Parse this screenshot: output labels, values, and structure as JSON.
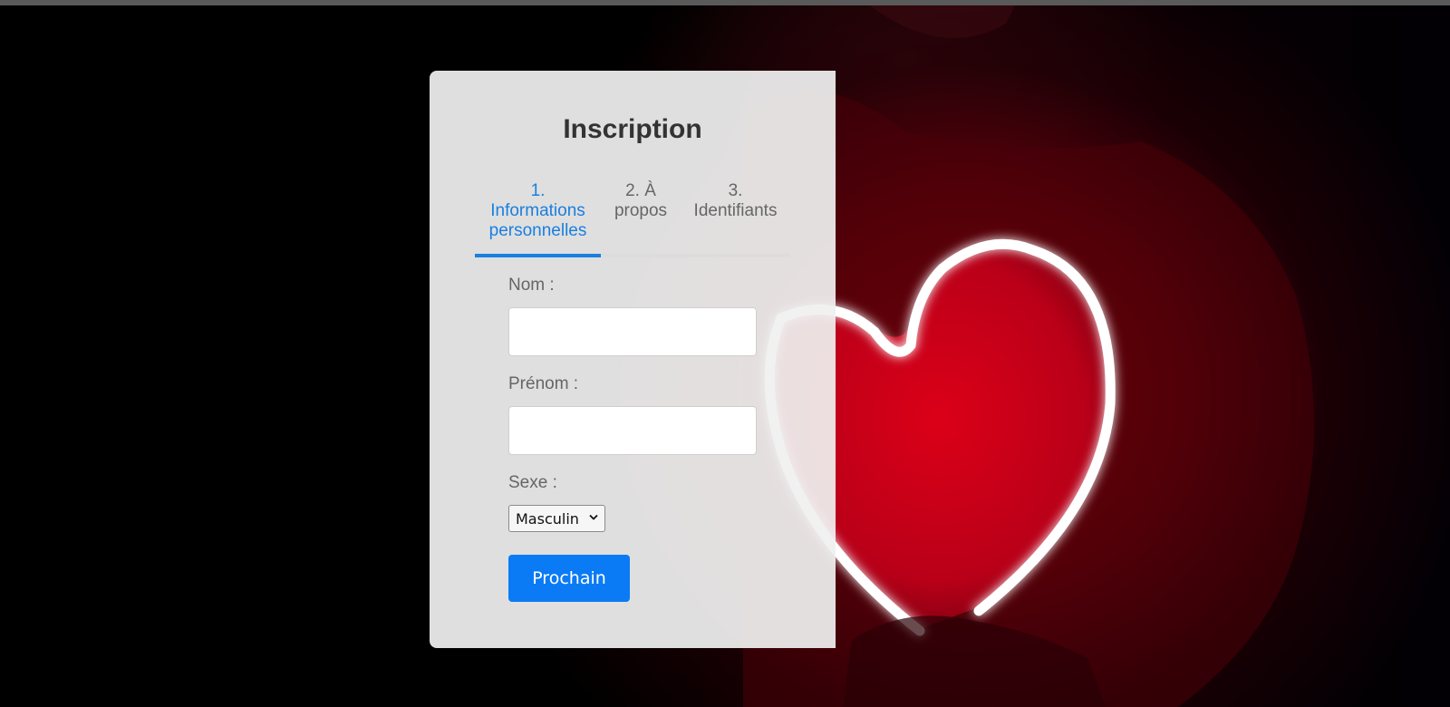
{
  "form": {
    "title": "Inscription",
    "tabs": [
      {
        "lines": [
          "1.",
          "Informations",
          "personnelles"
        ],
        "active": true
      },
      {
        "lines": [
          "2. À",
          "propos"
        ],
        "active": false
      },
      {
        "lines": [
          "3.",
          "Identifiants"
        ],
        "active": false
      }
    ],
    "step_progress": 0.4,
    "fields": {
      "nom_label": "Nom :",
      "nom_value": "",
      "prenom_label": "Prénom :",
      "prenom_value": "",
      "sexe_label": "Sexe :",
      "sexe_selected": "Masculin"
    },
    "next_label": "Prochain"
  },
  "colors": {
    "accent": "#0a7bf5",
    "tab_active": "#1a7fe0",
    "card_bg": "#f0f0f0",
    "neon": "#ffffff",
    "glow_red": "#e0001c"
  },
  "background": {
    "icon": "neon-heart-photo"
  }
}
